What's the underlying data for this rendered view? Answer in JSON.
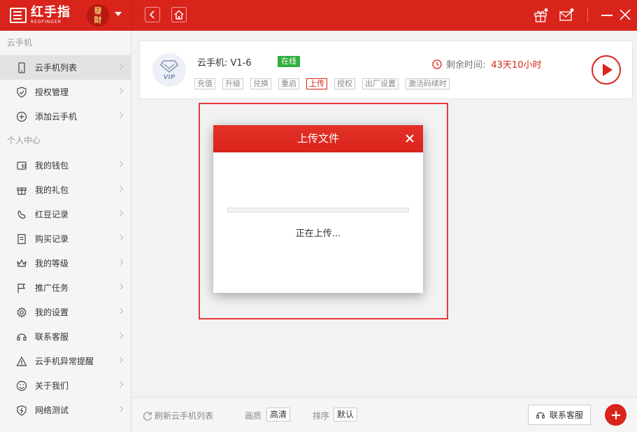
{
  "header": {
    "logo_cn": "红手指",
    "logo_en": "REDFINGER",
    "avatar_text_1": "發",
    "avatar_text_2": "財"
  },
  "sidebar": {
    "section_cloud": "云手机",
    "section_personal": "个人中心",
    "items": [
      {
        "label": "云手机列表",
        "icon": "phone-icon",
        "active": true
      },
      {
        "label": "授权管理",
        "icon": "shield-icon"
      },
      {
        "label": "添加云手机",
        "icon": "plus-circle-icon"
      },
      {
        "label": "我的钱包",
        "icon": "wallet-icon"
      },
      {
        "label": "我的礼包",
        "icon": "gift-icon"
      },
      {
        "label": "红豆记录",
        "icon": "bean-icon"
      },
      {
        "label": "购买记录",
        "icon": "receipt-icon"
      },
      {
        "label": "我的等级",
        "icon": "crown-icon"
      },
      {
        "label": "推广任务",
        "icon": "flag-icon"
      },
      {
        "label": "我的设置",
        "icon": "gear-icon"
      },
      {
        "label": "联系客服",
        "icon": "headset-icon"
      },
      {
        "label": "云手机异常提醒",
        "icon": "warning-icon"
      },
      {
        "label": "关于我们",
        "icon": "smile-icon"
      },
      {
        "label": "网络测试",
        "icon": "lightning-icon"
      }
    ]
  },
  "device": {
    "name": "云手机: V1-6",
    "status": "在线",
    "vip_label": "VIP",
    "actions": [
      "充值",
      "升级",
      "兑换",
      "重启",
      "上传",
      "授权",
      "出厂设置",
      "激活码续时"
    ],
    "active_action": "上传",
    "remaining_label": "剩余时间:",
    "remaining_value": "43天10小时"
  },
  "dialog": {
    "title": "上传文件",
    "status_text": "正在上传...",
    "progress": 0
  },
  "footer": {
    "refresh_label": "刷新云手机列表",
    "quality_label": "画质",
    "quality_value": "高清",
    "sort_label": "排序",
    "sort_value": "默认",
    "support_label": "联系客服"
  },
  "colors": {
    "brand_red": "#d9241c",
    "online_green": "#2fae3c",
    "highlight_red": "#e8383a"
  }
}
